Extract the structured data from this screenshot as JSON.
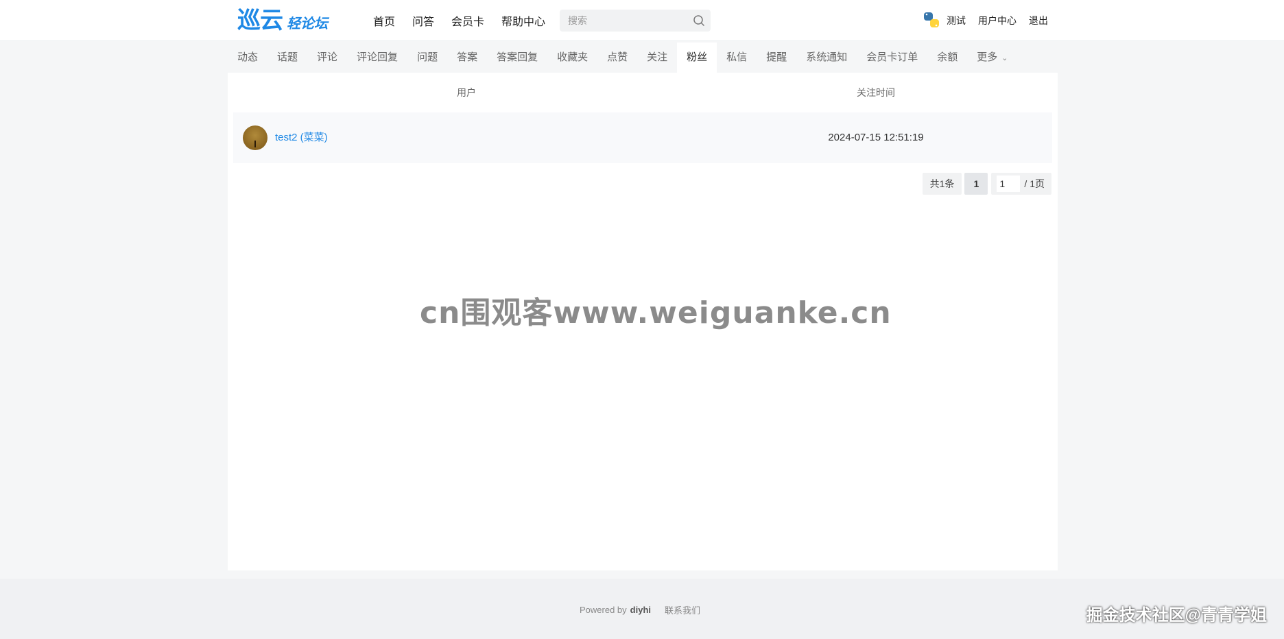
{
  "header": {
    "logo_main": "巡云",
    "logo_sub": "轻论坛",
    "nav": [
      "首页",
      "问答",
      "会员卡",
      "帮助中心"
    ],
    "search_placeholder": "搜索",
    "user_name": "测试",
    "user_center": "用户中心",
    "logout": "退出"
  },
  "tabs": {
    "items": [
      "动态",
      "话题",
      "评论",
      "评论回复",
      "问题",
      "答案",
      "答案回复",
      "收藏夹",
      "点赞",
      "关注",
      "粉丝",
      "私信",
      "提醒",
      "系统通知",
      "会员卡订单",
      "余额",
      "更多"
    ],
    "active": "粉丝"
  },
  "table": {
    "col_user": "用户",
    "col_time": "关注时间",
    "rows": [
      {
        "name": "test2 (菜菜)",
        "time": "2024-07-15 12:51:19"
      }
    ]
  },
  "pager": {
    "total": "共1条",
    "current": "1",
    "jump_value": "1",
    "pages": "/ 1页"
  },
  "watermark": "cn围观客www.weiguanke.cn",
  "footer": {
    "powered": "Powered by",
    "brand": "diyhi",
    "contact": "联系我们"
  },
  "corner_mark": "掘金技术社区@青青学姐",
  "colors": {
    "accent": "#1e88e5",
    "bg": "#f5f6f7"
  }
}
